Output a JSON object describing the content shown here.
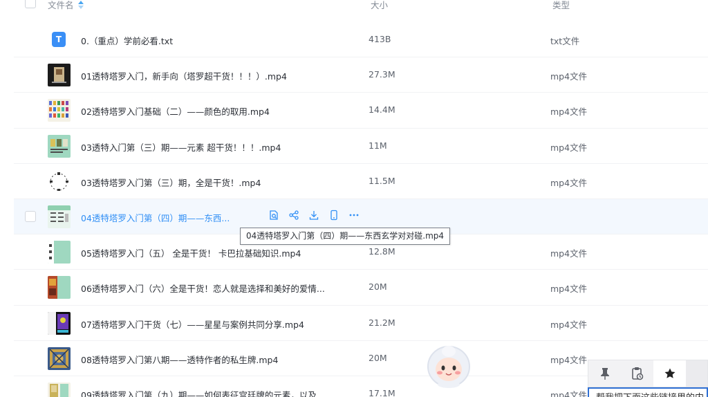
{
  "header": {
    "col_name": "文件名",
    "col_size": "大小",
    "col_type": "类型"
  },
  "files": [
    {
      "name": "0.（重点）学前必看.txt",
      "size": "413B",
      "type": "txt文件",
      "thumb": "txt-file-icon"
    },
    {
      "name": "01透特塔罗入门，新手向（塔罗超干货！！！）.mp4",
      "size": "27.3M",
      "type": "mp4文件",
      "thumb": "video-thumbnail"
    },
    {
      "name": "02透特塔罗入门基础（二）——颜色的取用.mp4",
      "size": "14.4M",
      "type": "mp4文件",
      "thumb": "video-thumbnail"
    },
    {
      "name": "03透特入门第（三）期——元素 超干货！！！.mp4",
      "size": "11M",
      "type": "mp4文件",
      "thumb": "video-thumbnail"
    },
    {
      "name": "03透特塔罗入门第（三）期，全是干货！.mp4",
      "size": "11.5M",
      "type": "mp4文件",
      "thumb": "video-thumbnail"
    },
    {
      "name": "04透特塔罗入门第（四）期——东西...",
      "size": "",
      "type": "",
      "thumb": "video-thumbnail"
    },
    {
      "name": "05透特塔罗入门（五） 全是干货！ 卡巴拉基础知识.mp4",
      "size": "12.8M",
      "type": "mp4文件",
      "thumb": "video-thumbnail"
    },
    {
      "name": "06透特塔罗入门（六）全是干货！恋人就是选择和美好的爱情...",
      "size": "20M",
      "type": "mp4文件",
      "thumb": "video-thumbnail"
    },
    {
      "name": "07透特塔罗入门干货（七）——星星与案例共同分享.mp4",
      "size": "21.2M",
      "type": "mp4文件",
      "thumb": "video-thumbnail"
    },
    {
      "name": "08透特塔罗入门第八期——透特作者的私生牌.mp4",
      "size": "20M",
      "type": "mp4文件",
      "thumb": "video-thumbnail"
    },
    {
      "name": "09透特塔罗入门第（九）期——如何表征宫廷牌的元素，以及...",
      "size": "17.1M",
      "type": "mp4文件",
      "thumb": "video-thumbnail"
    }
  ],
  "tooltip": "04透特塔罗入门第（四）期——东西玄学对对碰.mp4",
  "hover_actions": [
    "preview-icon",
    "share-icon",
    "download-icon",
    "phone-icon",
    "more-icon"
  ],
  "txt_icon_letter": "T",
  "float_toolbar": {
    "items": [
      "pin-icon",
      "clipboard-history-icon",
      "star-icon"
    ],
    "input_text": "帮我把下面这些链接里的内"
  },
  "colors": {
    "accent": "#2f8ef5",
    "hover_row": "#f3f8fe",
    "txt_icon": "#3a8ff6"
  }
}
